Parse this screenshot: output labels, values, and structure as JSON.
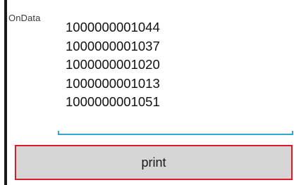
{
  "field": {
    "label": "OnData",
    "lines": [
      "1000000001044",
      "1000000001037",
      "1000000001020",
      "1000000001013",
      "1000000001051"
    ]
  },
  "button": {
    "label": "print"
  },
  "colors": {
    "focus_underline": "#33a3dc",
    "button_border": "#d91c1c",
    "button_background": "#d6d6d6"
  }
}
